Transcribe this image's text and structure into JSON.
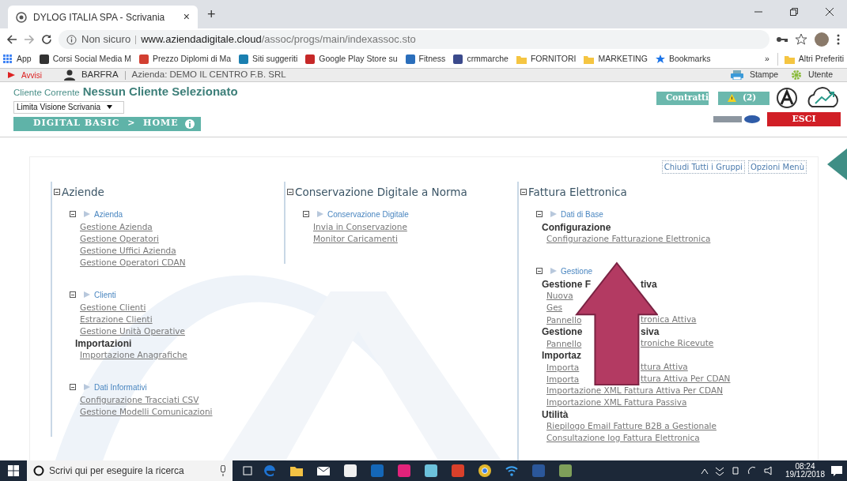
{
  "browser": {
    "tab_title": "DYLOG ITALIA SPA - Scrivania",
    "tab_close": "×",
    "new_tab": "+",
    "security": "Non sicuro",
    "url_host": "www.aziendadigitale.cloud",
    "url_path": "/assoc/progs/main/indexassoc.sto"
  },
  "bookmarks": [
    {
      "label": "App",
      "kind": "apps",
      "color": "#4285f4"
    },
    {
      "label": "Corsi Social Media M",
      "kind": "site",
      "color": "#333333"
    },
    {
      "label": "Prezzo Diplomi di Ma",
      "kind": "site",
      "color": "#d23f31"
    },
    {
      "label": "Siti suggeriti",
      "kind": "site",
      "color": "#1a7fb0"
    },
    {
      "label": "Google Play Store su",
      "kind": "site",
      "color": "#c62828"
    },
    {
      "label": "Fitness",
      "kind": "site",
      "color": "#2a6ebb"
    },
    {
      "label": "crmmarche",
      "kind": "site",
      "color": "#3b4a8c"
    },
    {
      "label": "FORNITORI",
      "kind": "folder",
      "color": "#f5c542"
    },
    {
      "label": "MARKETING",
      "kind": "folder",
      "color": "#f5c542"
    },
    {
      "label": "Bookmarks",
      "kind": "star",
      "color": "#1a73e8"
    },
    {
      "label": "»",
      "kind": "more"
    },
    {
      "label": "Altri Preferiti",
      "kind": "folder",
      "color": "#f5c542"
    }
  ],
  "topbar": {
    "alerts": "Avvisi",
    "user": "BARFRA",
    "company": "Azienda: DEMO IL CENTRO F.B. SRL",
    "actions": [
      {
        "label": "Stampe",
        "kind": "printer"
      },
      {
        "label": "Utente",
        "kind": "gear"
      }
    ]
  },
  "header": {
    "client_label": "Cliente Corrente",
    "client_value": "Nessun Cliente Selezionato",
    "filter": "Limita Visione Scrivania",
    "breadcrumb": "DIGITAL BASIC  >  HOME",
    "contracts": "Contratti",
    "alerts_count": "(2)",
    "exit": "ESCI"
  },
  "menu_tools": [
    "Chiudi Tutti i Gruppi",
    "Opzioni Menù"
  ],
  "groups": [
    {
      "title": "Aziende",
      "expanded": true,
      "sections": [
        {
          "title": "Azienda",
          "expanded": true,
          "items": [
            {
              "kind": "link",
              "text": "Gestione Azienda"
            },
            {
              "kind": "link",
              "text": "Gestione Operatori"
            },
            {
              "kind": "link",
              "text": "Gestione Uffici Azienda"
            },
            {
              "kind": "link",
              "text": "Gestione Operatori CDAN"
            }
          ]
        },
        {
          "title": "Clienti",
          "expanded": true,
          "items": [
            {
              "kind": "link",
              "text": "Gestione Clienti"
            },
            {
              "kind": "link",
              "text": "Estrazione Clienti"
            },
            {
              "kind": "link",
              "text": "Gestione Unità Operative"
            },
            {
              "kind": "heading",
              "text": "Importazioni"
            },
            {
              "kind": "link",
              "text": "Importazione Anagrafiche"
            }
          ]
        },
        {
          "title": "Dati Informativi",
          "expanded": true,
          "items": [
            {
              "kind": "link",
              "text": "Configurazione Tracciati CSV"
            },
            {
              "kind": "link",
              "text": "Gestione Modelli Comunicazioni"
            }
          ]
        }
      ]
    },
    {
      "title": "Conservazione Digitale a Norma",
      "expanded": true,
      "sections": [
        {
          "title": "Conservazione Digitale",
          "expanded": true,
          "items": [
            {
              "kind": "link",
              "text": "Invia in Conservazione"
            },
            {
              "kind": "link",
              "text": "Monitor Caricamenti"
            }
          ]
        }
      ]
    },
    {
      "title": "Fattura Elettronica",
      "expanded": true,
      "sections": [
        {
          "title": "Dati di Base",
          "expanded": true,
          "items": [
            {
              "kind": "heading",
              "text": "Configurazione"
            },
            {
              "kind": "link",
              "text": "Configurazione Fatturazione Elettronica"
            }
          ]
        },
        {
          "title": "Gestione",
          "expanded": true,
          "items": [
            {
              "kind": "heading",
              "text": "Gestione F",
              "text_right": "tiva"
            },
            {
              "kind": "link",
              "text": "Nuova"
            },
            {
              "kind": "link",
              "text": "Ges"
            },
            {
              "kind": "link",
              "text": "Pannello",
              "text_right": "tronica Attiva"
            },
            {
              "kind": "heading",
              "text": "Gestione",
              "text_right": "siva"
            },
            {
              "kind": "link",
              "text": "Pannello",
              "text_right": "troniche Ricevute"
            },
            {
              "kind": "heading",
              "text": "Importaz"
            },
            {
              "kind": "link",
              "text": "Importa",
              "text_right": "ttura Attiva"
            },
            {
              "kind": "link",
              "text": "Importa",
              "text_right": "ttura Attiva Per CDAN"
            },
            {
              "kind": "link",
              "text": "Importazione XML Fattura Attiva Per CDAN"
            },
            {
              "kind": "link",
              "text": "Importazione XML Fattura Passiva"
            },
            {
              "kind": "heading",
              "text": "Utilità"
            },
            {
              "kind": "link",
              "text": "Riepilogo Email Fatture B2B a Gestionale"
            },
            {
              "kind": "link",
              "text": "Consultazione log Fattura Elettronica"
            }
          ]
        }
      ]
    }
  ],
  "taskbar": {
    "search_placeholder": "Scrivi qui per eseguire la ricerca",
    "apps": [
      {
        "kind": "edge",
        "color": "#1e73d2"
      },
      {
        "kind": "folder",
        "color": "#f3c244"
      },
      {
        "kind": "mail",
        "color": "#ffffff"
      },
      {
        "kind": "store",
        "color": "#f0f0f0"
      },
      {
        "kind": "outlook",
        "color": "#1467b8"
      },
      {
        "kind": "app",
        "color": "#e2237b"
      },
      {
        "kind": "app",
        "color": "#6cc2dc"
      },
      {
        "kind": "app",
        "color": "#d9402b"
      },
      {
        "kind": "chrome",
        "color": "#e2b72d"
      },
      {
        "kind": "wifi",
        "color": "#3aa0f0"
      },
      {
        "kind": "word",
        "color": "#2b579a"
      },
      {
        "kind": "app",
        "color": "#7fa05a"
      }
    ],
    "time": "08:24",
    "date": "19/12/2018"
  }
}
